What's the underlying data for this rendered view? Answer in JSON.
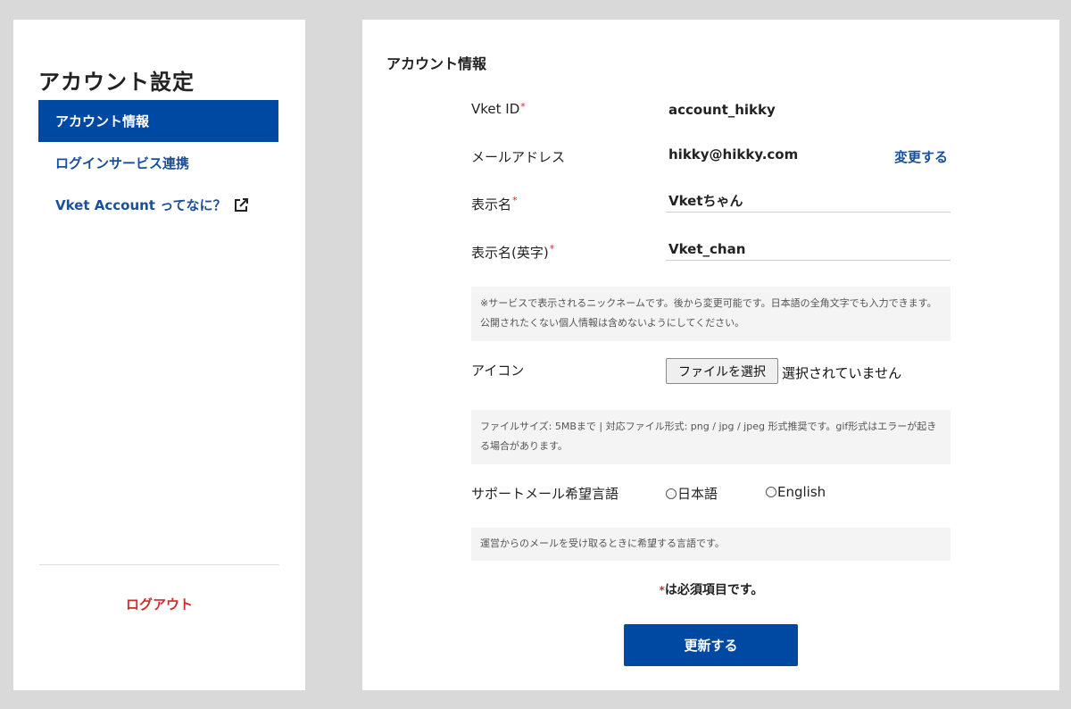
{
  "sidebar": {
    "title": "アカウント設定",
    "items": [
      {
        "label": "アカウント情報",
        "active": true
      },
      {
        "label": "ログインサービス連携",
        "active": false
      },
      {
        "label": "Vket Account ってなに？",
        "active": false,
        "icon": "external-link-icon"
      }
    ],
    "logout_label": "ログアウト"
  },
  "main": {
    "title": "アカウント情報",
    "required_mark": "*",
    "fields": {
      "vket_id": {
        "label": "Vket ID",
        "value": "account_hikky"
      },
      "email": {
        "label": "メールアドレス",
        "value": "hikky@hikky.com",
        "change_link": "変更する"
      },
      "display_name": {
        "label": "表示名",
        "value": "Vketちゃん"
      },
      "display_name_en": {
        "label": "表示名(英字)",
        "value": "Vket_chan"
      },
      "icon": {
        "label": "アイコン",
        "button_label": "ファイルを選択",
        "status": "選択されていません"
      },
      "support_language": {
        "label": "サポートメール希望言語",
        "options": [
          "日本語",
          "English"
        ]
      }
    },
    "notes": {
      "nickname": "※サービスで表示されるニックネームです。後から変更可能です。日本語の全角文字でも入力できます。公開されたくない個人情報は含めないようにしてください。",
      "file": "ファイルサイズ: 5MBまで | 対応ファイル形式: png / jpg / jpeg 形式推奨です。gif形式はエラーが起きる場合があります。",
      "language": "運営からのメールを受け取るときに希望する言語です。"
    },
    "required_note": "は必須項目です。",
    "submit_label": "更新する"
  },
  "colors": {
    "primary": "#0049a3",
    "link": "#1a4f9c",
    "required": "#d12b2b",
    "background": "#d9d9d9"
  }
}
